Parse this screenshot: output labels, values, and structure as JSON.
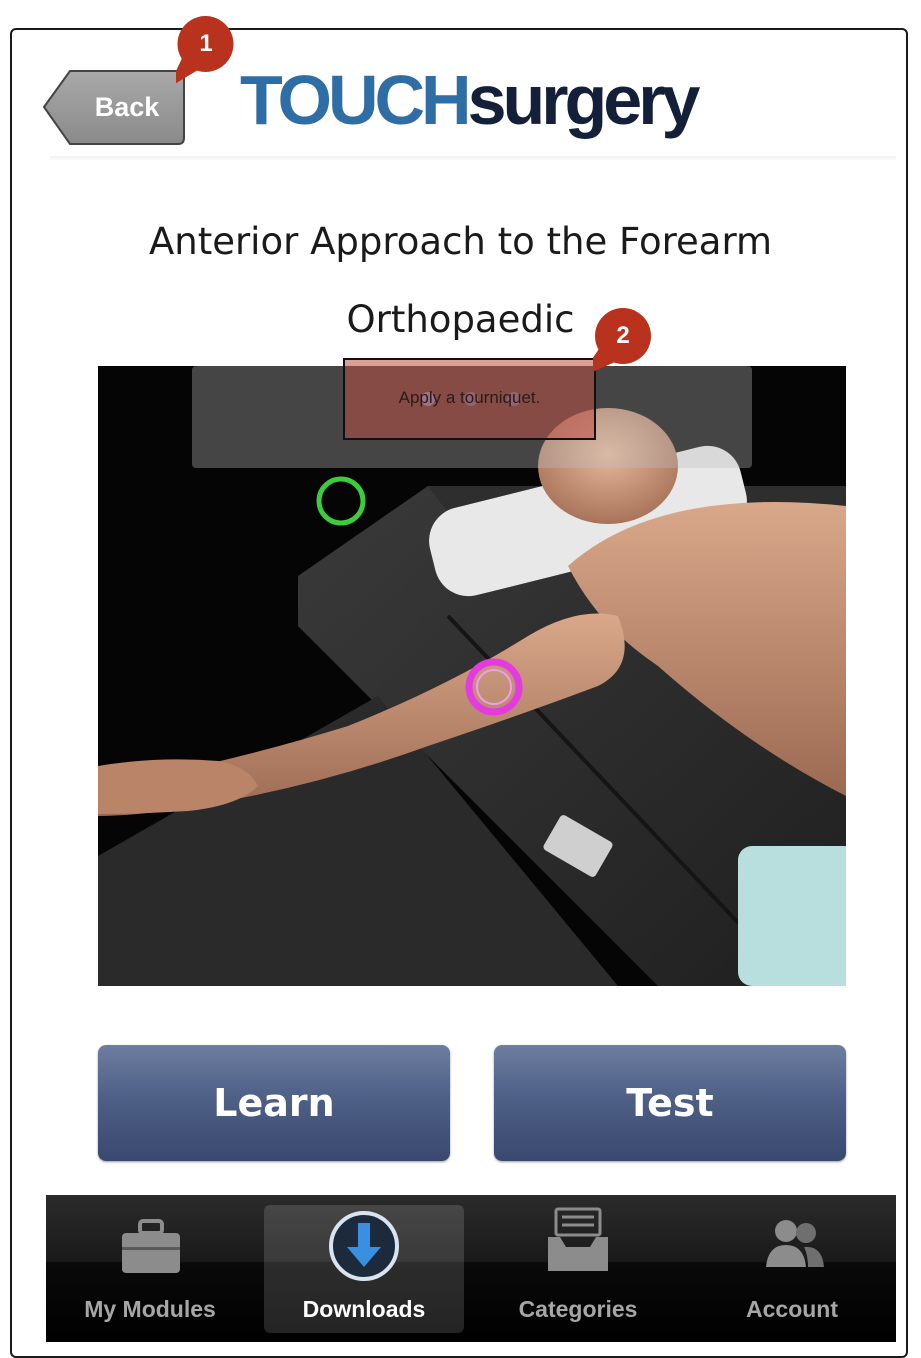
{
  "header": {
    "back_label": "Back",
    "logo_part1": "TOUCH",
    "logo_part2": "surgery"
  },
  "module": {
    "title": "Anterior Approach to the Forearm",
    "category": "Orthopaedic"
  },
  "viewer": {
    "instruction": "Apply a tourniquet.",
    "annotation_colors": {
      "target_green": "#3ccc3c",
      "target_magenta": "#e43be0"
    }
  },
  "callouts": [
    "1",
    "2"
  ],
  "actions": {
    "learn_label": "Learn",
    "test_label": "Test"
  },
  "tabbar": {
    "items": [
      {
        "label": "My Modules",
        "icon": "briefcase-icon",
        "active": false
      },
      {
        "label": "Downloads",
        "icon": "download-arrow-icon",
        "active": true
      },
      {
        "label": "Categories",
        "icon": "tray-icon",
        "active": false
      },
      {
        "label": "Account",
        "icon": "people-icon",
        "active": false
      }
    ]
  },
  "colors": {
    "logo_blue": "#2f6ea5",
    "logo_navy": "#14203a",
    "button_blue": "#4f6087",
    "callout_red": "#b8321e"
  }
}
